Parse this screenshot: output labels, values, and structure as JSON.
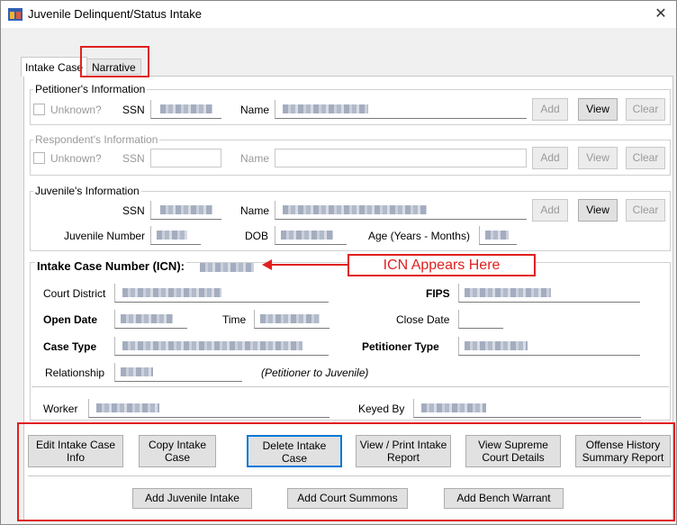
{
  "window": {
    "title": "Juvenile Delinquent/Status Intake",
    "close_glyph": "✕"
  },
  "tabs": [
    {
      "label": "Intake Case",
      "active": true
    },
    {
      "label": "Narrative",
      "active": false
    }
  ],
  "petitioner": {
    "legend": "Petitioner's Information",
    "unknown_label": "Unknown?",
    "ssn_label": "SSN",
    "name_label": "Name",
    "add": "Add",
    "view": "View",
    "clear": "Clear"
  },
  "respondent": {
    "legend": "Respondent's Information",
    "unknown_label": "Unknown?",
    "ssn_label": "SSN",
    "name_label": "Name",
    "add": "Add",
    "view": "View",
    "clear": "Clear"
  },
  "juvenile": {
    "legend": "Juvenile's Information",
    "ssn_label": "SSN",
    "name_label": "Name",
    "add": "Add",
    "view": "View",
    "clear": "Clear",
    "number_label": "Juvenile Number",
    "dob_label": "DOB",
    "age_label": "Age (Years - Months)"
  },
  "intake": {
    "icn_label": "Intake Case Number (ICN):",
    "callout": "ICN Appears Here",
    "court_district_label": "Court District",
    "fips_label": "FIPS",
    "open_date_label": "Open Date",
    "time_label": "Time",
    "close_date_label": "Close Date",
    "case_type_label": "Case Type",
    "petitioner_type_label": "Petitioner Type",
    "relationship_label": "Relationship",
    "relationship_note": "(Petitioner to Juvenile)",
    "worker_label": "Worker",
    "keyed_by_label": "Keyed By"
  },
  "actions": {
    "row1": [
      "Edit Intake Case Info",
      "Copy Intake Case",
      "Delete Intake Case",
      "View / Print Intake Report",
      "View Supreme Court Details",
      "Offense History Summary Report"
    ],
    "row2": [
      "Add Juvenile Intake",
      "Add Court Summons",
      "Add Bench Warrant"
    ]
  },
  "colors": {
    "highlight": "#e02020",
    "focus": "#0078d7"
  }
}
